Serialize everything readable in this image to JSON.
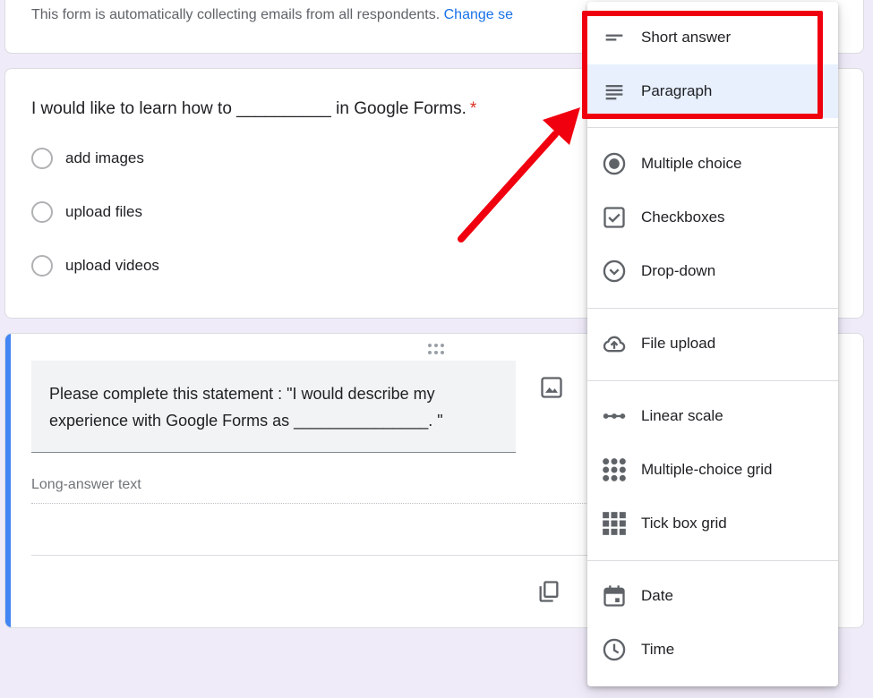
{
  "top_card": {
    "notice": "This form is automatically collecting emails from all respondents.",
    "link": "Change se"
  },
  "question1": {
    "title": "I would like to learn how to __________ in Google Forms.",
    "required_mark": "*",
    "options": [
      "add images",
      "upload files",
      "upload videos"
    ]
  },
  "question2": {
    "title_line1": "Please complete this statement :  \"I would describe my",
    "title_line2": "experience with Google Forms as _______________. \"",
    "answer_placeholder": "Long-answer text"
  },
  "question_type_menu": {
    "items": [
      {
        "label": "Short answer",
        "icon": "short-answer-icon"
      },
      {
        "label": "Paragraph",
        "icon": "paragraph-icon",
        "selected": true
      },
      {
        "label": "Multiple choice",
        "icon": "radio-button-icon"
      },
      {
        "label": "Checkboxes",
        "icon": "checkbox-icon"
      },
      {
        "label": "Drop-down",
        "icon": "dropdown-circle-icon"
      },
      {
        "label": "File upload",
        "icon": "cloud-upload-icon"
      },
      {
        "label": "Linear scale",
        "icon": "linear-scale-icon"
      },
      {
        "label": "Multiple-choice grid",
        "icon": "dot-grid-icon"
      },
      {
        "label": "Tick box grid",
        "icon": "square-grid-icon"
      },
      {
        "label": "Date",
        "icon": "calendar-icon"
      },
      {
        "label": "Time",
        "icon": "clock-icon"
      }
    ]
  },
  "colors": {
    "background": "#f0ebf8",
    "accent_blue": "#4285f4",
    "theme_purple": "#673ab7",
    "annotation_red": "#f0000f",
    "selected_item": "#e8f0fe",
    "link": "#1a73e8"
  }
}
